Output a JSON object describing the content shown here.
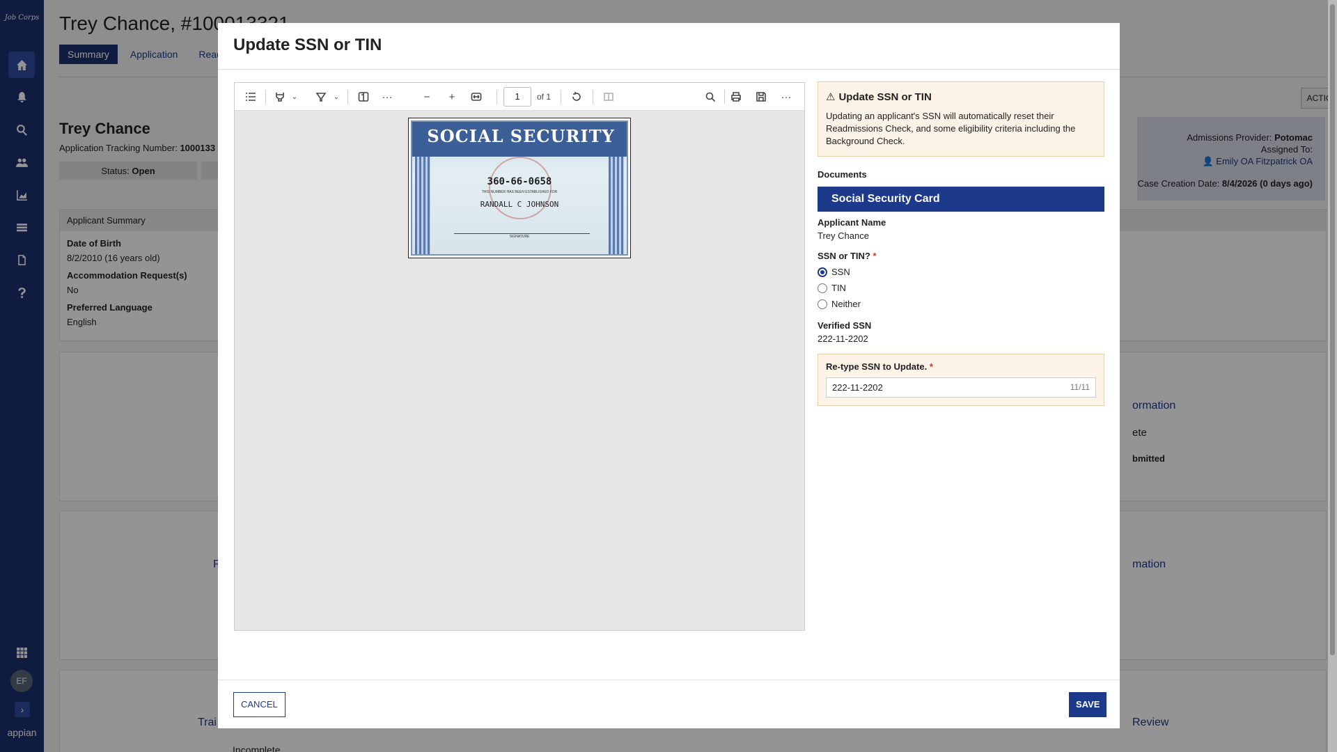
{
  "nav": {
    "logo": "Job Corps",
    "user_initials": "EF",
    "brand": "appian"
  },
  "page": {
    "title": "Trey Chance, #100013321",
    "tabs": [
      "Summary",
      "Application",
      "Readm"
    ],
    "name": "Trey Chance",
    "atn_label": "Application Tracking Number:",
    "atn_value": "1000133",
    "status_label": "Status:",
    "status_value": "Open",
    "actions": "ACTIONS",
    "admissions_provider_label": "Admissions Provider:",
    "admissions_provider_value": "Potomac",
    "assigned_to_label": "Assigned To:",
    "assigned_to_value": "Emily OA Fitzpatrick OA",
    "case_creation_label": "Case Creation Date:",
    "case_creation_value": "8/4/2026 (0 days ago)",
    "summary_header": "Applicant Summary",
    "summary": [
      {
        "label": "Date of Birth",
        "value": "8/2/2010 (16 years old)"
      },
      {
        "label": "Accommodation Request(s)",
        "value": "No"
      },
      {
        "label": "Preferred Language",
        "value": "English"
      }
    ],
    "peek": [
      "ormation",
      "ete",
      "bmitted",
      "mation",
      "Trai",
      "Review",
      "Incomplete",
      "R"
    ]
  },
  "modal": {
    "title": "Update SSN or TIN",
    "viewer": {
      "page_current": "1",
      "page_total": "of 1"
    },
    "card": {
      "header": "SOCIAL SECURITY",
      "number": "360-66-0658",
      "small_text": "THIS NUMBER HAS BEEN ESTABLISHED FOR",
      "name": "RANDALL C JOHNSON",
      "signature": "SIGNATURE"
    },
    "warning": {
      "title": "Update SSN or TIN",
      "text": "Updating an applicant's SSN will automatically reset their Readmissions Check, and some eligibility criteria including the Background Check."
    },
    "documents_label": "Documents",
    "document_name": "Social Security Card",
    "applicant_name_label": "Applicant Name",
    "applicant_name_value": "Trey Chance",
    "ssn_tin_label": "SSN or TIN?",
    "required_mark": "*",
    "options": [
      "SSN",
      "TIN",
      "Neither"
    ],
    "selected_option": "SSN",
    "verified_ssn_label": "Verified SSN",
    "verified_ssn_value": "222-11-2202",
    "retype_label": "Re-type SSN to Update.",
    "retype_value": "222-11-2202",
    "retype_counter": "11/11",
    "cancel": "CANCEL",
    "save": "SAVE"
  },
  "colors": {
    "nav": "#1d2f6f",
    "accent": "#1d3a8a",
    "warning_bg": "#fdf3e7"
  }
}
